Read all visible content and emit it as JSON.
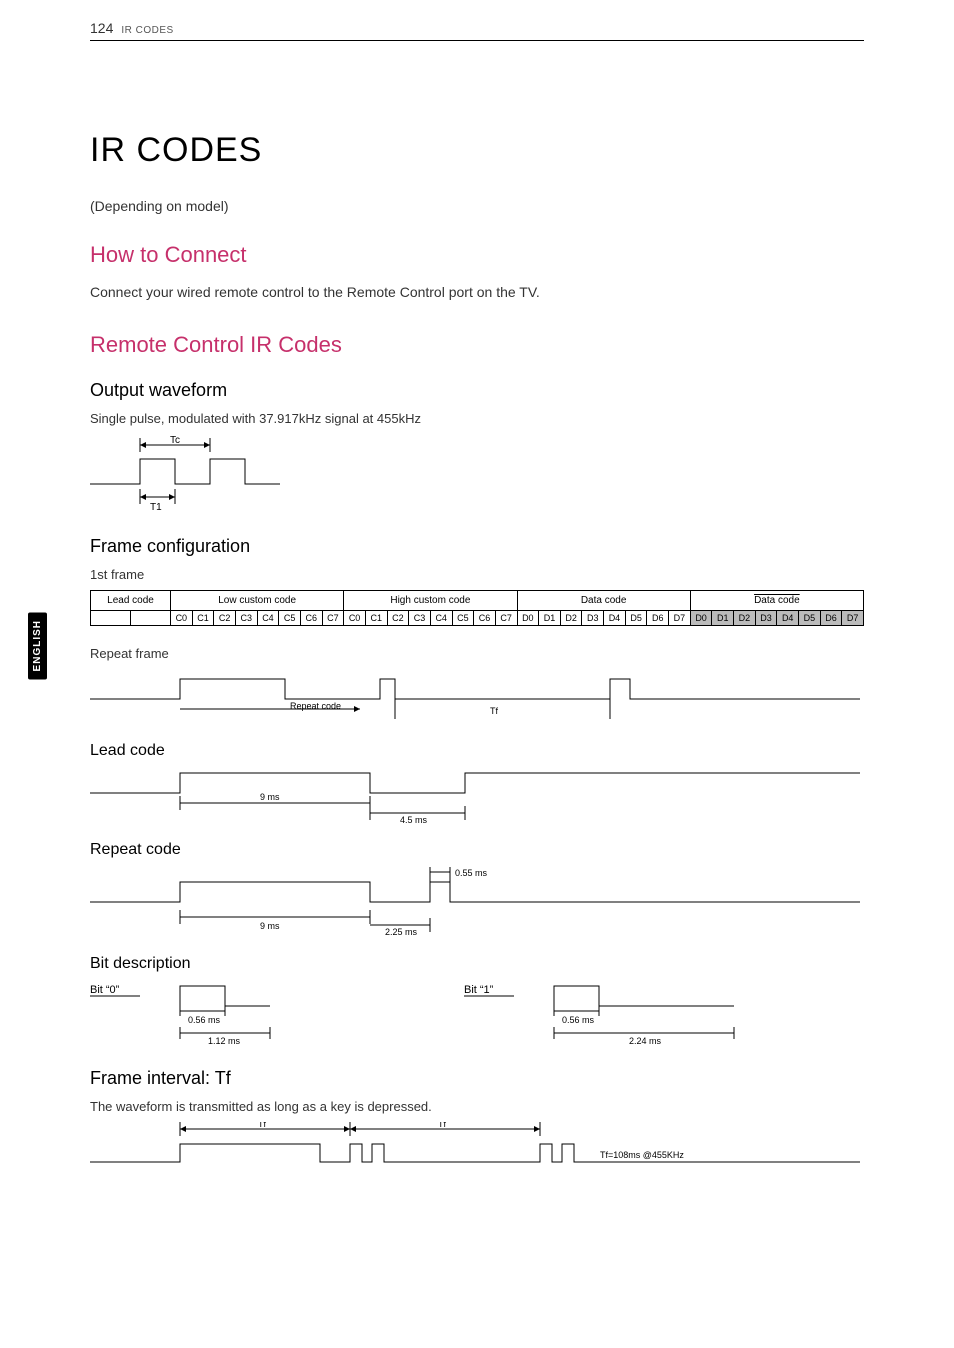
{
  "header": {
    "page_number": "124",
    "section_label": "IR CODES"
  },
  "side_tab": "ENGLISH",
  "title": "IR CODES",
  "depending_note": "(Depending on model)",
  "how_to_connect": {
    "heading": "How to Connect",
    "body": "Connect your wired remote control to the Remote Control port on the TV."
  },
  "remote_ir": {
    "heading": "Remote Control IR Codes",
    "output_waveform": {
      "heading": "Output waveform",
      "body": "Single pulse, modulated with 37.917kHz signal at 455kHz",
      "tc_label": "Tc",
      "t1_label": "T1"
    },
    "frame_config": {
      "heading": "Frame configuration",
      "first_frame_label": "1st frame",
      "columns": {
        "lead": "Lead code",
        "low": "Low custom code",
        "high": "High custom code",
        "data1": "Data code",
        "data2": "Data code"
      },
      "bits_c": [
        "C0",
        "C1",
        "C2",
        "C3",
        "C4",
        "C5",
        "C6",
        "C7"
      ],
      "bits_d": [
        "D0",
        "D1",
        "D2",
        "D3",
        "D4",
        "D5",
        "D6",
        "D7"
      ],
      "repeat_frame_label": "Repeat frame",
      "repeat_code_label": "Repeat  code",
      "tf_label": "Tf"
    },
    "lead_code": {
      "heading": "Lead code",
      "t9": "9 ms",
      "t45": "4.5 ms"
    },
    "repeat_code": {
      "heading": "Repeat code",
      "t9": "9 ms",
      "t225": "2.25 ms",
      "t055": "0.55 ms"
    },
    "bit_desc": {
      "heading": "Bit description",
      "bit0": "Bit “0”",
      "bit1": "Bit “1”",
      "t056": "0.56 ms",
      "t112": "1.12 ms",
      "t224": "2.24 ms"
    },
    "frame_interval": {
      "heading": "Frame interval: Tf",
      "body": "The waveform is transmitted as long as a key is depressed.",
      "tf_label": "Tf",
      "tf_value": "Tf=108ms @455KHz"
    }
  }
}
